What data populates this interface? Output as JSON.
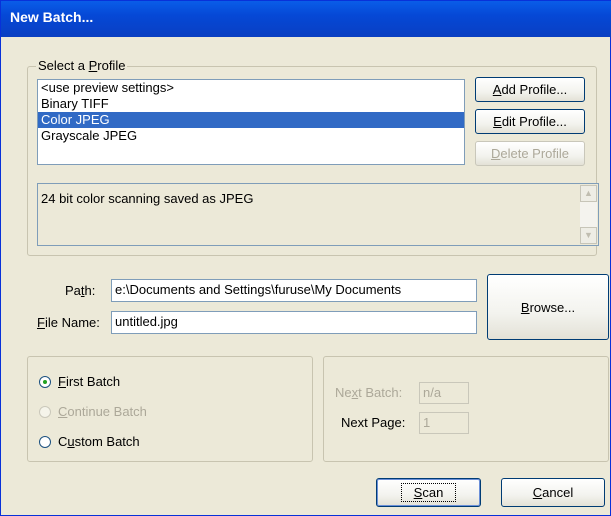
{
  "window": {
    "title": "New Batch..."
  },
  "profile_group": {
    "title": "Select a Profile",
    "items": [
      {
        "label": "<use preview settings>",
        "selected": false
      },
      {
        "label": "Binary TIFF",
        "selected": false
      },
      {
        "label": "Color JPEG",
        "selected": true
      },
      {
        "label": "Grayscale JPEG",
        "selected": false
      }
    ],
    "add_button": "Add Profile...",
    "edit_button": "Edit Profile...",
    "delete_button": "Delete Profile",
    "description": "24 bit color scanning saved as JPEG"
  },
  "path": {
    "label": "Path:",
    "value": "e:\\Documents and Settings\\furuse\\My Documents"
  },
  "file_name": {
    "label": "File Name:",
    "value": "untitled.jpg"
  },
  "browse_button": "Browse...",
  "batch_options": {
    "first": "First Batch",
    "continue": "Continue Batch",
    "custom": "Custom Batch",
    "selected": "first"
  },
  "next": {
    "batch_label": "Next Batch:",
    "batch_value": "n/a",
    "page_label": "Next Page:",
    "page_value": "1"
  },
  "buttons": {
    "scan": "Scan",
    "cancel": "Cancel"
  }
}
